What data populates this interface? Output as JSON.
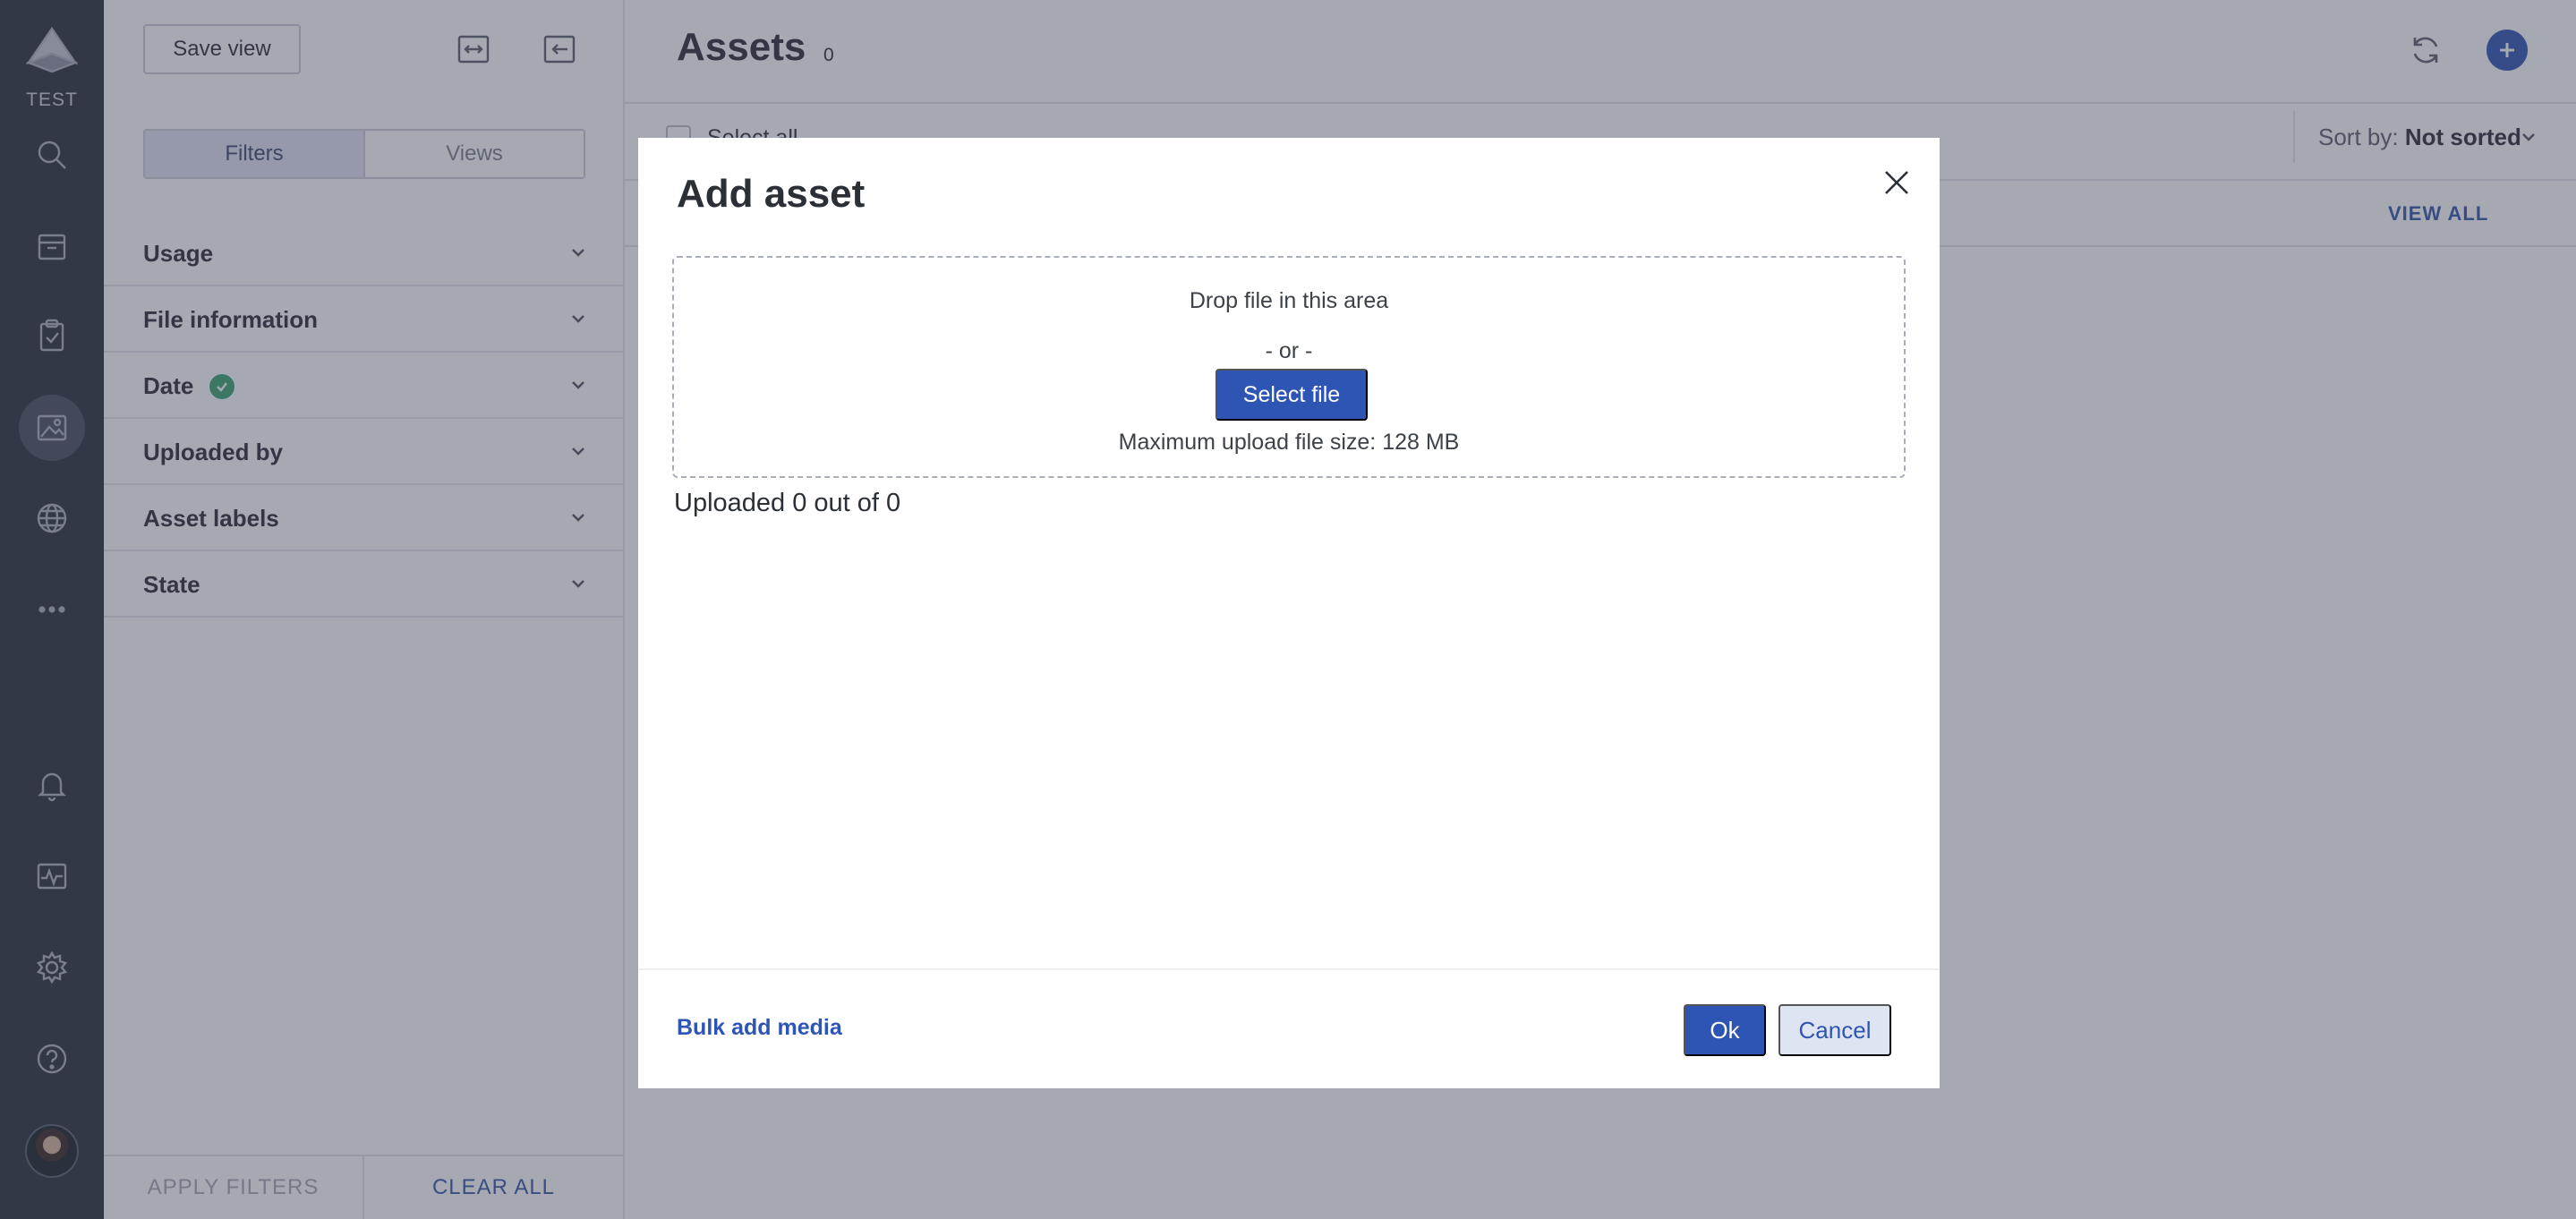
{
  "nav": {
    "env_label": "TEST",
    "items": [
      {
        "icon": "search-icon"
      },
      {
        "icon": "inbox-icon"
      },
      {
        "icon": "clipboard-check-icon"
      },
      {
        "icon": "image-icon",
        "active": true
      },
      {
        "icon": "globe-icon"
      },
      {
        "icon": "more-icon"
      },
      {
        "icon": "bell-icon"
      },
      {
        "icon": "activity-icon"
      },
      {
        "icon": "gear-icon"
      },
      {
        "icon": "help-icon"
      }
    ]
  },
  "filters_panel": {
    "save_view_label": "Save view",
    "tabs": {
      "filters": "Filters",
      "views": "Views"
    },
    "sections": [
      {
        "label": "Usage"
      },
      {
        "label": "File information"
      },
      {
        "label": "Date",
        "applied": true
      },
      {
        "label": "Uploaded by"
      },
      {
        "label": "Asset labels"
      },
      {
        "label": "State"
      }
    ],
    "apply_label": "APPLY FILTERS",
    "clear_label": "CLEAR ALL"
  },
  "main": {
    "title": "Assets",
    "count": "0",
    "select_all": "Select all",
    "sort_prefix": "Sort by:",
    "sort_value": "Not sorted",
    "view_all": "VIEW ALL"
  },
  "modal": {
    "title": "Add asset",
    "drop_text": "Drop file in this area",
    "or_text": "- or -",
    "select_file": "Select file",
    "max_size": "Maximum upload file size: 128 MB",
    "uploaded_status": "Uploaded 0 out of 0",
    "bulk_add": "Bulk add media",
    "ok": "Ok",
    "cancel": "Cancel"
  },
  "colors": {
    "rail": "#2c3039",
    "primary": "#2f55b4",
    "secondary_bg": "#dfe4f2",
    "success": "#3aa56b",
    "overlay": "rgba(60,66,88,0.46)"
  }
}
